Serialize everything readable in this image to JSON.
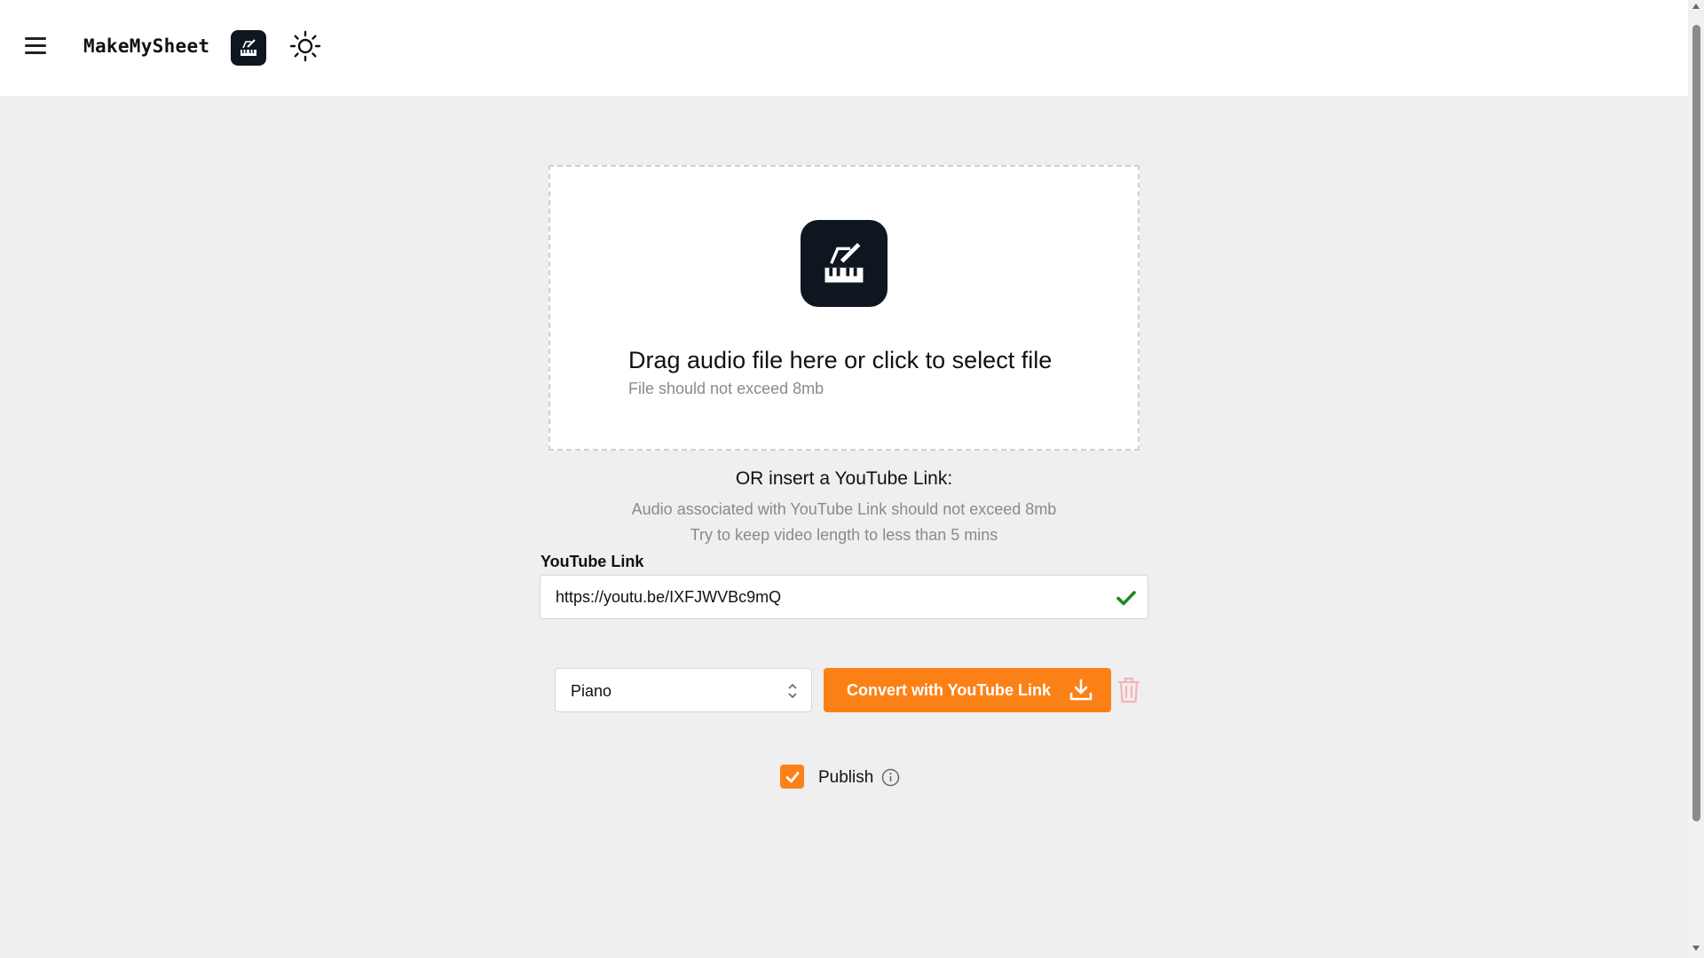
{
  "header": {
    "brand": "MakeMySheet",
    "menu_icon": "hamburger-menu-icon",
    "logo_icon": "piano-sheet-logo-icon",
    "theme_icon": "sun-icon"
  },
  "dropzone": {
    "title": "Drag audio file here or click to select file",
    "subtitle": "File should not exceed 8mb",
    "logo_icon": "piano-sheet-logo-icon"
  },
  "youtube": {
    "heading": "OR insert a YouTube Link:",
    "hint_size": "Audio associated with YouTube Link should not exceed 8mb",
    "hint_length": "Try to keep video length to less than 5 mins",
    "label": "YouTube Link",
    "value": "https://youtu.be/IXFJWVBc9mQ",
    "valid_icon": "checkmark-icon"
  },
  "controls": {
    "instrument": "Piano",
    "convert_label": "Convert with YouTube Link",
    "download_icon": "download-icon",
    "delete_icon": "trash-icon"
  },
  "publish": {
    "label": "Publish",
    "checked": true,
    "info_icon": "info-icon"
  },
  "colors": {
    "accent": "#fb8117",
    "logo_bg": "#0e1620",
    "valid": "#1a8a1a",
    "trash": "#f4b4b4"
  }
}
